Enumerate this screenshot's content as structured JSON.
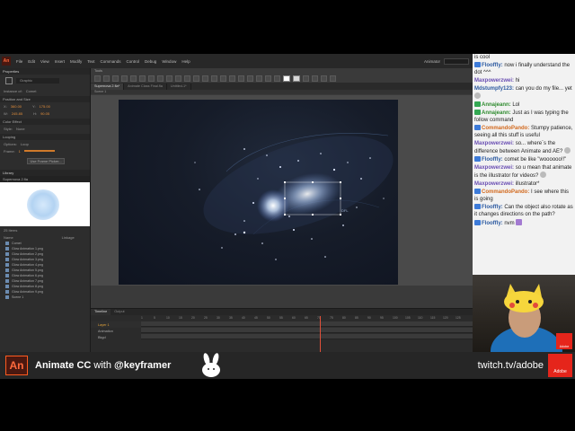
{
  "app": {
    "logo": "An",
    "menu": [
      "File",
      "Edit",
      "View",
      "Insert",
      "Modify",
      "Text",
      "Commands",
      "Control",
      "Debug",
      "Window",
      "Help"
    ],
    "workspace_label": "Animator"
  },
  "properties": {
    "tab": "Properties",
    "symbol_name": "Graphic",
    "instance_of_label": "Instance of:",
    "instance_of_value": "Comet",
    "position_section": "Position and Size",
    "x_label": "X:",
    "x_value": "360.00",
    "y_label": "Y:",
    "y_value": "175.00",
    "w_label": "W:",
    "w_value": "245.85",
    "h_label": "H:",
    "h_value": "90.05",
    "color_section": "Color Effect",
    "style_label": "Style:",
    "style_value": "None",
    "looping_section": "Looping",
    "options_label": "Options:",
    "options_value": "Loop",
    "frame_label": "Frame:",
    "frame_value": "1",
    "use_frame_button": "Use Frame Picker..."
  },
  "library": {
    "tab": "Library",
    "document": "Supernova 2.fla",
    "count_label": "25 Items",
    "col_name": "Name",
    "col_linkage": "Linkage",
    "items": [
      "Comet",
      "Glow Animation 1.png",
      "Glow Animation 2.png",
      "Glow Animation 3.png",
      "Glow Animation 4.png",
      "Glow Animation 5.png",
      "Glow Animation 6.png",
      "Glow Animation 7.png",
      "Glow Animation 8.png",
      "Glow Animation 9.png",
      "Scene 1"
    ]
  },
  "tools": {
    "label": "Tools"
  },
  "document_tabs": [
    "Supernova 2.fla*",
    "Animate Class Final.fla",
    "Untitled-1*"
  ],
  "scene_label": "Scene 1",
  "timeline": {
    "tabs": [
      "Timeline",
      "Output"
    ],
    "ruler": [
      "1",
      "5",
      "10",
      "15",
      "20",
      "25",
      "30",
      "35",
      "40",
      "45",
      "50",
      "55",
      "60",
      "65",
      "70",
      "75",
      "80",
      "85",
      "90",
      "95",
      "100",
      "105",
      "110",
      "115",
      "120",
      "125"
    ],
    "layers": [
      "Layer 1",
      "Animation",
      "Bkgd"
    ]
  },
  "chat": [
    {
      "user": "",
      "text": "is cool",
      "color": "none"
    },
    {
      "user": "Flooffly:",
      "text": "now i finally understand the dot ^^^",
      "color": "blue",
      "badge": "#3d7bd9"
    },
    {
      "user": "Maxpowerzwei:",
      "text": "hi",
      "color": "purple"
    },
    {
      "user": "Mdstumpfy123:",
      "text": "can you do my file... yet",
      "color": "blue",
      "emote": true
    },
    {
      "user": "Annajeann:",
      "text": "Lol",
      "color": "green",
      "badge": "#34a853"
    },
    {
      "user": "Annajeann:",
      "text": "Just as I was typing the follow command",
      "color": "green",
      "badge": "#34a853"
    },
    {
      "user": "CommandoPando:",
      "text": "Stumpy patience, seeing all this stuff is useful",
      "color": "orange",
      "badge": "#3d7bd9"
    },
    {
      "user": "Maxpowerzwei:",
      "text": "so... where`s the difference between Animate and AE?",
      "color": "purple",
      "emote": true
    },
    {
      "user": "Flooffly:",
      "text": "comet be like \"woooooo!!\"",
      "color": "blue",
      "badge": "#3d7bd9"
    },
    {
      "user": "Maxpowerzwei:",
      "text": "so u mean that animate is the illustrator for videos?",
      "color": "purple",
      "emote": true
    },
    {
      "user": "Maxpowerzwei:",
      "text": "illustrator*",
      "color": "purple"
    },
    {
      "user": "CommandoPando:",
      "text": "I see where this is going",
      "color": "orange",
      "badge": "#3d7bd9"
    },
    {
      "user": "Flooffly:",
      "text": "Can the object also rotate as it changes directions on the path?",
      "color": "blue",
      "badge": "#3d7bd9"
    },
    {
      "user": "Flooffly:",
      "text": "nvm",
      "color": "blue",
      "badge": "#3d7bd9",
      "emote_purple": true
    }
  ],
  "cam": {
    "adobe_label": "Adobe"
  },
  "banner": {
    "logo": "An",
    "product": "Animate CC",
    "with": " with ",
    "handle": "@keyframer",
    "url": "twitch.tv/adobe",
    "adobe_label": "Adobe"
  },
  "colors": {
    "accent": "#ff5a1f",
    "adobe_red": "#e5251b",
    "stage_bg": "#161c29"
  }
}
